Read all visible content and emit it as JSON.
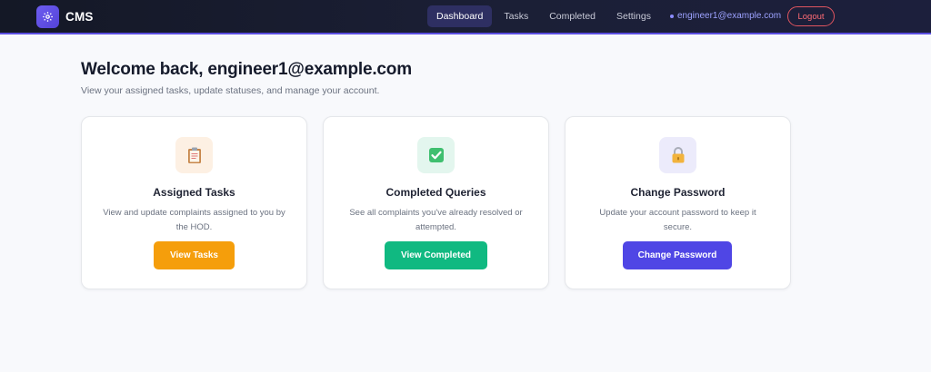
{
  "brand": {
    "name": "CMS",
    "icon": "gear-icon",
    "accent": "#6d5cf0"
  },
  "nav": {
    "links": [
      {
        "label": "Dashboard",
        "active": true
      },
      {
        "label": "Tasks",
        "active": false
      },
      {
        "label": "Completed",
        "active": false
      },
      {
        "label": "Settings",
        "active": false
      }
    ],
    "user_email": "engineer1@example.com",
    "logout_label": "Logout"
  },
  "main": {
    "welcome": "Welcome back, engineer1@example.com",
    "subtitle": "View your assigned tasks, update statuses, and manage your account."
  },
  "cards": [
    {
      "icon": "clipboard-icon",
      "title": "Assigned Tasks",
      "description": "View and update complaints assigned to you by the HOD.",
      "button_label": "View Tasks",
      "button_color": "#f59e0b",
      "icon_bg": "#fdf0e3"
    },
    {
      "icon": "checkbox-icon",
      "title": "Completed Queries",
      "description": "See all complaints you've already resolved or attempted.",
      "button_label": "View Completed",
      "button_color": "#10b981",
      "icon_bg": "#e3f6ee"
    },
    {
      "icon": "lock-icon",
      "title": "Change Password",
      "description": "Update your account password to keep it secure.",
      "button_label": "Change Password",
      "button_color": "#4f46e5",
      "icon_bg": "#ecebfb"
    }
  ]
}
